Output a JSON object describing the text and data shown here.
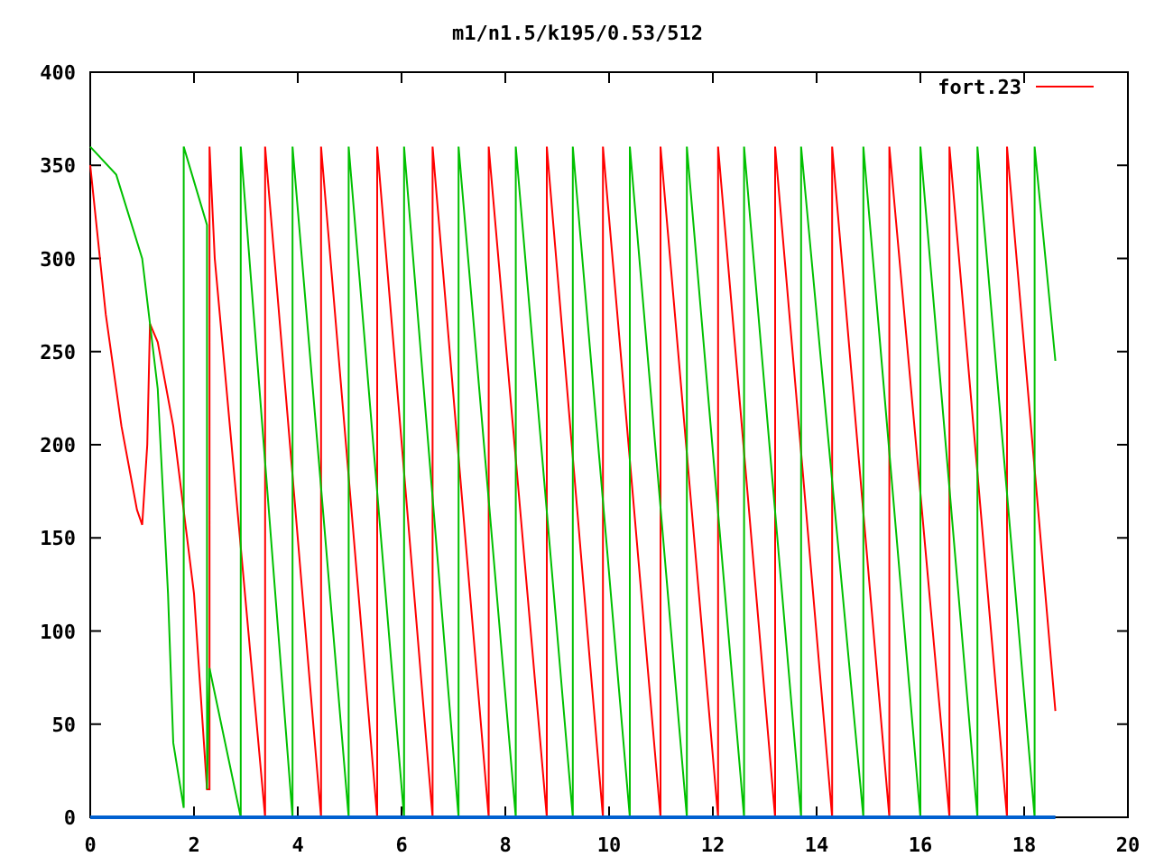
{
  "plot": {
    "chart_data": {
      "type": "line",
      "title": "m1/n1.5/k195/0.53/512",
      "xlim": [
        0,
        20
      ],
      "ylim": [
        0,
        400
      ],
      "xticks": [
        0,
        2,
        4,
        6,
        8,
        10,
        12,
        14,
        16,
        18,
        20
      ],
      "yticks": [
        0,
        50,
        100,
        150,
        200,
        250,
        300,
        350,
        400
      ],
      "series": [
        {
          "name": "fort.23",
          "color": "#ff0000",
          "x": [
            0,
            0.3,
            0.6,
            0.9,
            1.0,
            1.1,
            1.15,
            1.3,
            1.6,
            2.0,
            2.25,
            2.3,
            2.3,
            2.4,
            3.37,
            3.37,
            4.45,
            4.45,
            5.53,
            5.53,
            6.6,
            6.6,
            7.68,
            7.68,
            8.8,
            8.8,
            9.88,
            9.88,
            10.99,
            10.99,
            12.1,
            12.1,
            13.2,
            13.2,
            14.3,
            14.3,
            15.4,
            15.4,
            16.56,
            16.56,
            17.67,
            17.67,
            18.6
          ],
          "values": [
            350,
            270,
            210,
            165,
            157,
            200,
            265,
            255,
            210,
            120,
            15,
            15,
            360,
            300,
            0,
            360,
            0,
            360,
            0,
            360,
            0,
            360,
            0,
            360,
            0,
            360,
            0,
            360,
            0,
            360,
            0,
            360,
            0,
            360,
            0,
            360,
            0,
            360,
            0,
            360,
            0,
            360,
            57
          ]
        },
        {
          "color": "#00c000",
          "x": [
            0,
            0.5,
            1.0,
            1.3,
            1.5,
            1.6,
            1.8,
            1.8,
            2.25,
            2.25,
            2.3,
            2.9,
            2.9,
            3.9,
            3.9,
            4.98,
            4.98,
            6.05,
            6.05,
            7.1,
            7.1,
            8.2,
            8.2,
            9.3,
            9.3,
            10.4,
            10.4,
            11.5,
            11.5,
            12.6,
            12.6,
            13.7,
            13.7,
            14.9,
            14.9,
            16.0,
            16.0,
            17.1,
            17.1,
            18.2,
            18.2,
            18.6
          ],
          "values": [
            360,
            345,
            300,
            230,
            120,
            40,
            5,
            360,
            318,
            15,
            80,
            0,
            360,
            0,
            360,
            0,
            360,
            0,
            360,
            0,
            360,
            0,
            360,
            0,
            360,
            0,
            360,
            0,
            360,
            0,
            360,
            0,
            360,
            0,
            360,
            0,
            360,
            0,
            360,
            0,
            360,
            245
          ]
        },
        {
          "color": "#0060d0",
          "x": [
            0,
            18.6
          ],
          "values": [
            0,
            0
          ]
        }
      ]
    }
  }
}
